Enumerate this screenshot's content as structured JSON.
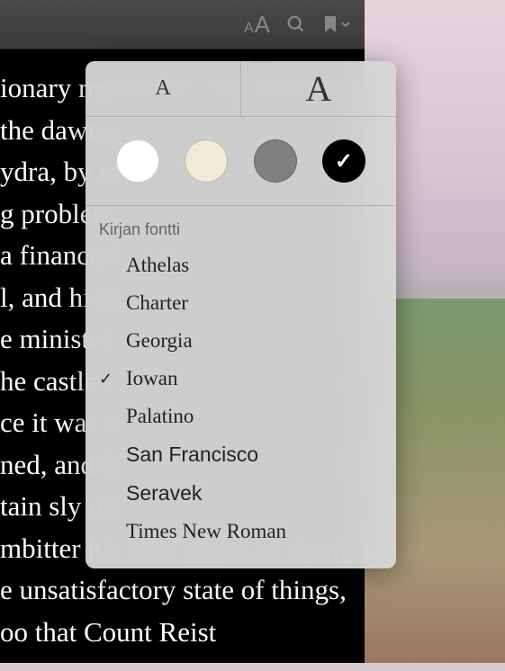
{
  "toolbar": {
    "font_button": "aA",
    "search_icon": "search",
    "bookmark_icon": "bookmark"
  },
  "book_lines": [
    "ionary revolution, and close upon",
    "the dawn of the nineteenth cen-",
    "ydra, by name Pozharkov, was hav-",
    "g problems typical of a nobleman",
    "a financial dilemma. He was a w-",
    "l, and his name was known onstr-",
    "e minister of finance as lord of a",
    "he castle in central Russia; and,",
    "ce it was made impossible for c-",
    "ned, and though he has exhibited",
    "tain  sly  resourcefulness  in  the",
    "mbitter his wife Berta, to change",
    "e  unsatisfactory  state  of  things,",
    "oo that Count Reist"
  ],
  "size_control": {
    "decrease": "A",
    "increase": "A"
  },
  "themes": {
    "white": "#ffffff",
    "sepia": "#f2ead6",
    "gray": "#808080",
    "black": "#000000",
    "selected": "black"
  },
  "font_section": {
    "header": "Kirjan fontti",
    "fonts": [
      {
        "name": "Athelas",
        "selected": false,
        "class": "font-athelas"
      },
      {
        "name": "Charter",
        "selected": false,
        "class": "font-charter"
      },
      {
        "name": "Georgia",
        "selected": false,
        "class": "font-georgia"
      },
      {
        "name": "Iowan",
        "selected": true,
        "class": "font-iowan"
      },
      {
        "name": "Palatino",
        "selected": false,
        "class": "font-palatino"
      },
      {
        "name": "San Francisco",
        "selected": false,
        "class": "font-sanfrancisco"
      },
      {
        "name": "Seravek",
        "selected": false,
        "class": "font-seravek"
      },
      {
        "name": "Times New Roman",
        "selected": false,
        "class": "font-times"
      }
    ]
  }
}
